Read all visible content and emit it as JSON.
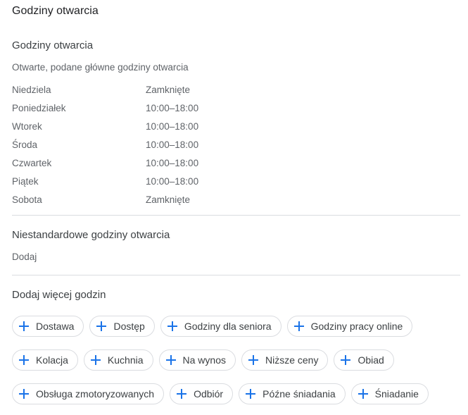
{
  "page_title": "Godziny otwarcia",
  "regular": {
    "title": "Godziny otwarcia",
    "subtitle": "Otwarte, podane główne godziny otwarcia",
    "days": [
      {
        "day": "Niedziela",
        "hours": "Zamknięte"
      },
      {
        "day": "Poniedziałek",
        "hours": "10:00–18:00"
      },
      {
        "day": "Wtorek",
        "hours": "10:00–18:00"
      },
      {
        "day": "Środa",
        "hours": "10:00–18:00"
      },
      {
        "day": "Czwartek",
        "hours": "10:00–18:00"
      },
      {
        "day": "Piątek",
        "hours": "10:00–18:00"
      },
      {
        "day": "Sobota",
        "hours": "Zamknięte"
      }
    ]
  },
  "special": {
    "title": "Niestandardowe godziny otwarcia",
    "add_label": "Dodaj"
  },
  "more": {
    "title": "Dodaj więcej godzin",
    "icon": "plus-icon",
    "accent_color": "#1a73e8",
    "chips": [
      "Dostawa",
      "Dostęp",
      "Godziny dla seniora",
      "Godziny pracy online",
      "Kolacja",
      "Kuchnia",
      "Na wynos",
      "Niższe ceny",
      "Obiad",
      "Obsługa zmotoryzowanych",
      "Odbiór",
      "Późne śniadania",
      "Śniadanie"
    ]
  }
}
